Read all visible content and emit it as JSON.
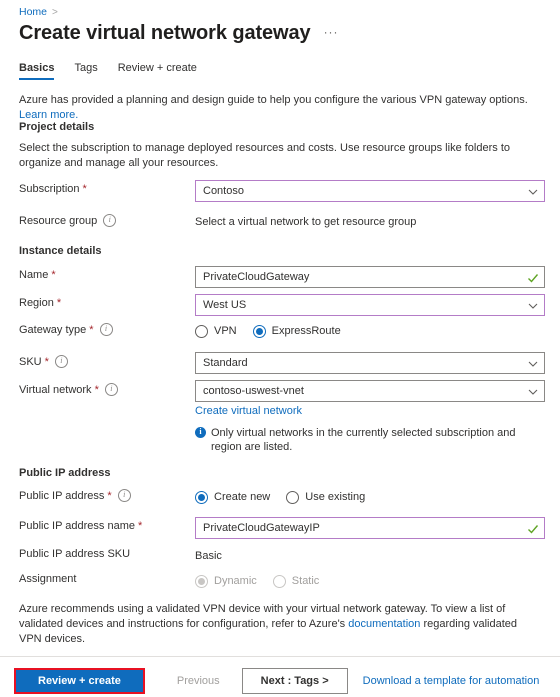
{
  "breadcrumb": {
    "home_label": "Home",
    "separator": ">"
  },
  "header": {
    "title": "Create virtual network gateway",
    "ellipsis": "···"
  },
  "tabs": [
    {
      "label": "Basics",
      "active": true
    },
    {
      "label": "Tags",
      "active": false
    },
    {
      "label": "Review + create",
      "active": false
    }
  ],
  "intro": {
    "text": "Azure has provided a planning and design guide to help you configure the various VPN gateway options.",
    "link": "Learn more."
  },
  "project_details": {
    "heading": "Project details",
    "description": "Select the subscription to manage deployed resources and costs. Use resource groups like folders to organize and manage all your resources.",
    "subscription": {
      "label": "Subscription",
      "required": "*",
      "value": "Contoso"
    },
    "resource_group": {
      "label": "Resource group",
      "value": "Select a virtual network to get resource group"
    }
  },
  "instance_details": {
    "heading": "Instance details",
    "name": {
      "label": "Name",
      "required": "*",
      "value": "PrivateCloudGateway"
    },
    "region": {
      "label": "Region",
      "required": "*",
      "value": "West US"
    },
    "gateway_type": {
      "label": "Gateway type",
      "required": "*",
      "options": [
        {
          "label": "VPN",
          "checked": false
        },
        {
          "label": "ExpressRoute",
          "checked": true
        }
      ]
    },
    "sku": {
      "label": "SKU",
      "required": "*",
      "value": "Standard"
    },
    "virtual_network": {
      "label": "Virtual network",
      "required": "*",
      "value": "contoso-uswest-vnet",
      "create_link": "Create virtual network",
      "note": "Only virtual networks in the currently selected subscription and region are listed."
    }
  },
  "public_ip": {
    "heading": "Public IP address",
    "address": {
      "label": "Public IP address",
      "required": "*",
      "options": [
        {
          "label": "Create new",
          "checked": true
        },
        {
          "label": "Use existing",
          "checked": false
        }
      ]
    },
    "address_name": {
      "label": "Public IP address name",
      "required": "*",
      "value": "PrivateCloudGatewayIP"
    },
    "address_sku": {
      "label": "Public IP address SKU",
      "value": "Basic"
    },
    "assignment": {
      "label": "Assignment",
      "options": [
        {
          "label": "Dynamic",
          "checked": true
        },
        {
          "label": "Static",
          "checked": false
        }
      ]
    }
  },
  "footer_note": {
    "text_before": "Azure recommends using a validated VPN device with your virtual network gateway. To view a list of validated devices and instructions for configuration, refer to Azure's ",
    "link": "documentation",
    "text_after": " regarding validated VPN devices."
  },
  "commandbar": {
    "review_create": "Review + create",
    "previous": "Previous",
    "next": "Next : Tags >",
    "download_template": "Download a template for automation"
  },
  "colors": {
    "accent_blue": "#0f6cbd",
    "focus_purple": "#b47cc7",
    "required_red": "#a4262c",
    "highlight_red": "#e81123",
    "valid_green": "#5fa424"
  }
}
